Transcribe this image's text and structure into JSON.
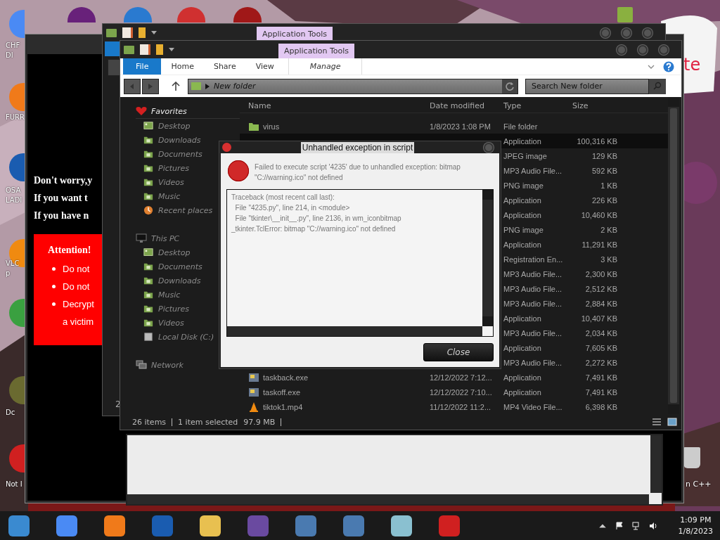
{
  "desktop": {
    "icons": [
      {
        "lines": [
          "CHF",
          "DI"
        ]
      },
      {
        "lines": [
          "FURR"
        ]
      },
      {
        "lines": [
          "OSA",
          "LADI"
        ]
      },
      {
        "lines": [
          "VLC",
          "p"
        ]
      },
      {
        "lines": [
          "Dc"
        ]
      },
      {
        "lines": [
          "Not I"
        ]
      }
    ],
    "right_label": "n C++",
    "note_fragment": "te"
  },
  "ransom_window": {
    "lines": [
      "Don't worry,y",
      "If you want t",
      "If you have n"
    ],
    "attention": {
      "title": "Attention!",
      "items": [
        {
          "lines": [
            "Do not"
          ]
        },
        {
          "lines": [
            "Do not"
          ]
        },
        {
          "lines": [
            "Decrypt",
            "a victim"
          ]
        }
      ]
    }
  },
  "back_explorer": {
    "context_tab": "Application Tools",
    "status": "2"
  },
  "explorer": {
    "context_tab": "Application Tools",
    "ribbon_tabs": [
      {
        "label": "File",
        "selected": true
      },
      {
        "label": "Home",
        "selected": false
      },
      {
        "label": "Share",
        "selected": false
      },
      {
        "label": "View",
        "selected": false
      },
      {
        "label": "Manage",
        "selected": false
      }
    ],
    "address": "New folder",
    "search": {
      "placeholder": "Search New folder"
    },
    "nav": [
      {
        "label": "Favorites",
        "kind": "favorites",
        "selected": true,
        "children": [
          {
            "label": "Desktop",
            "kind": "desktop"
          },
          {
            "label": "Downloads",
            "kind": "folder"
          },
          {
            "label": "Documents",
            "kind": "folder"
          },
          {
            "label": "Pictures",
            "kind": "folder"
          },
          {
            "label": "Videos",
            "kind": "folder"
          },
          {
            "label": "Music",
            "kind": "folder"
          },
          {
            "label": "Recent places",
            "kind": "recent"
          }
        ]
      },
      {
        "label": "This PC",
        "kind": "pc",
        "selected": false,
        "children": [
          {
            "label": "Desktop",
            "kind": "desktop"
          },
          {
            "label": "Documents",
            "kind": "folder"
          },
          {
            "label": "Downloads",
            "kind": "folder"
          },
          {
            "label": "Music",
            "kind": "folder"
          },
          {
            "label": "Pictures",
            "kind": "folder"
          },
          {
            "label": "Videos",
            "kind": "folder"
          },
          {
            "label": "Local Disk (C:)",
            "kind": "drive"
          }
        ]
      },
      {
        "label": "Network",
        "kind": "network",
        "selected": false
      }
    ],
    "columns": [
      "Name",
      "Date modified",
      "Type",
      "Size"
    ],
    "rows": [
      {
        "name": "virus",
        "date": "1/8/2023 1:08 PM",
        "type": "File folder",
        "size": "",
        "kind": "folder",
        "selected": false
      },
      {
        "type": "Application",
        "size": "100,316 KB",
        "selected": true
      },
      {
        "type": "JPEG image",
        "size": "129 KB",
        "selected": false
      },
      {
        "type": "MP3 Audio File...",
        "size": "592 KB",
        "selected": false
      },
      {
        "type": "PNG image",
        "size": "1 KB",
        "selected": false
      },
      {
        "type": "Application",
        "size": "226 KB",
        "selected": false
      },
      {
        "type": "Application",
        "size": "10,460 KB",
        "selected": false
      },
      {
        "type": "PNG image",
        "size": "2 KB",
        "selected": false
      },
      {
        "type": "Application",
        "size": "11,291 KB",
        "selected": false
      },
      {
        "type": "Registration En...",
        "size": "3 KB",
        "selected": false
      },
      {
        "type": "MP3 Audio File...",
        "size": "2,300 KB",
        "selected": false
      },
      {
        "type": "MP3 Audio File...",
        "size": "2,512 KB",
        "selected": false
      },
      {
        "type": "MP3 Audio File...",
        "size": "2,884 KB",
        "selected": false
      },
      {
        "type": "Application",
        "size": "10,407 KB",
        "selected": false
      },
      {
        "type": "MP3 Audio File...",
        "size": "2,034 KB",
        "selected": false
      },
      {
        "type": "Application",
        "size": "7,605 KB",
        "selected": false
      },
      {
        "type": "MP3 Audio File...",
        "size": "2,272 KB",
        "selected": false
      },
      {
        "name": "taskback.exe",
        "date": "12/12/2022 7:12...",
        "type": "Application",
        "size": "7,491 KB",
        "kind": "app",
        "selected": false
      },
      {
        "name": "taskoff.exe",
        "date": "12/12/2022 7:10...",
        "type": "Application",
        "size": "7,491 KB",
        "kind": "app",
        "selected": false
      },
      {
        "name": "tiktok1.mp4",
        "date": "11/12/2022 11:2...",
        "type": "MP4 Video File...",
        "size": "6,398 KB",
        "kind": "video",
        "selected": false
      }
    ],
    "status": {
      "count": "26 items",
      "selected": "1 item selected",
      "size": "97.9 MB"
    }
  },
  "dialog": {
    "title": "Unhandled exception in script",
    "title_highlighted": true,
    "message": "Failed to execute script '4235' due to unhandled exception: bitmap \"C://warning.ico\" not defined",
    "traceback": [
      "Traceback (most recent call last):",
      "  File \"4235.py\", line 214, in <module>",
      "  File \"tkinter\\__init__.py\", line 2136, in wm_iconbitmap",
      "_tkinter.TclError: bitmap \"C://warning.ico\" not defined"
    ],
    "button": "Close"
  },
  "taskbar": {
    "time": "1:09 PM",
    "date": "1/8/2023"
  }
}
